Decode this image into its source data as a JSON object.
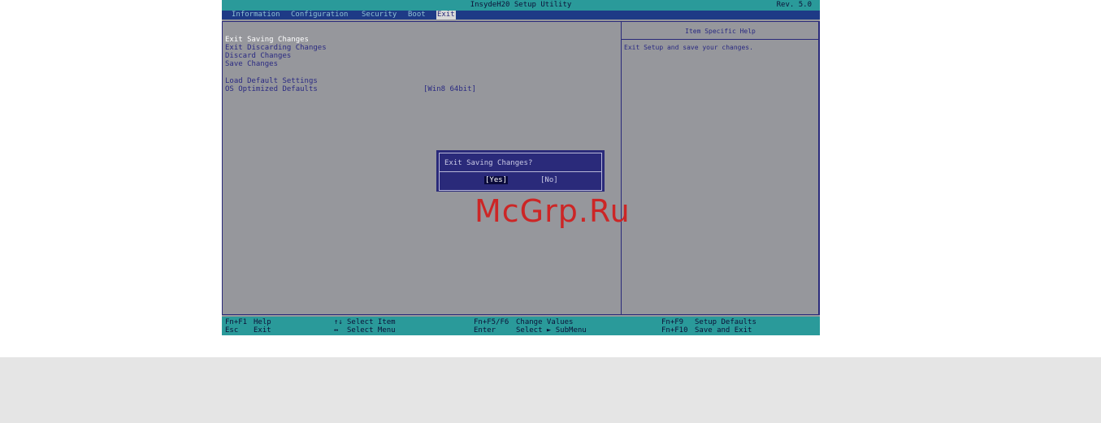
{
  "titlebar": {
    "title": "InsydeH20 Setup Utility",
    "revision": "Rev. 5.0"
  },
  "menu": {
    "tabs": [
      "Information",
      "Configuration",
      "Security",
      "Boot",
      "Exit"
    ],
    "active": "Exit"
  },
  "exit_items": [
    "Exit Saving Changes",
    "Exit Discarding Changes",
    "Discard Changes",
    "Save Changes",
    "Load Default Settings",
    "OS Optimized Defaults"
  ],
  "os_optimized_value": "[Win8 64bit]",
  "help": {
    "title": "Item Specific Help",
    "text": "Exit Setup and save your changes."
  },
  "dialog": {
    "title": "Exit Saving Changes?",
    "yes": "[Yes]",
    "no": "[No]"
  },
  "status": [
    {
      "key": "Fn+F1",
      "action": "Help"
    },
    {
      "key": "Esc",
      "action": "Exit"
    },
    {
      "key": "↑↓",
      "action": "Select Item"
    },
    {
      "key": "↔",
      "action": "Select Menu"
    },
    {
      "key": "Fn+F5/F6",
      "action": "Change Values"
    },
    {
      "key": "Enter",
      "action": "Select ► SubMenu"
    },
    {
      "key": "Fn+F9",
      "action": "Setup Defaults"
    },
    {
      "key": "Fn+F10",
      "action": "Save and Exit"
    }
  ],
  "watermark": "McGrp.Ru",
  "colors": {
    "teal": "#2a9a9a",
    "navy": "#2a2a7a",
    "panel": "#96979c",
    "watermark": "#cc2626"
  }
}
